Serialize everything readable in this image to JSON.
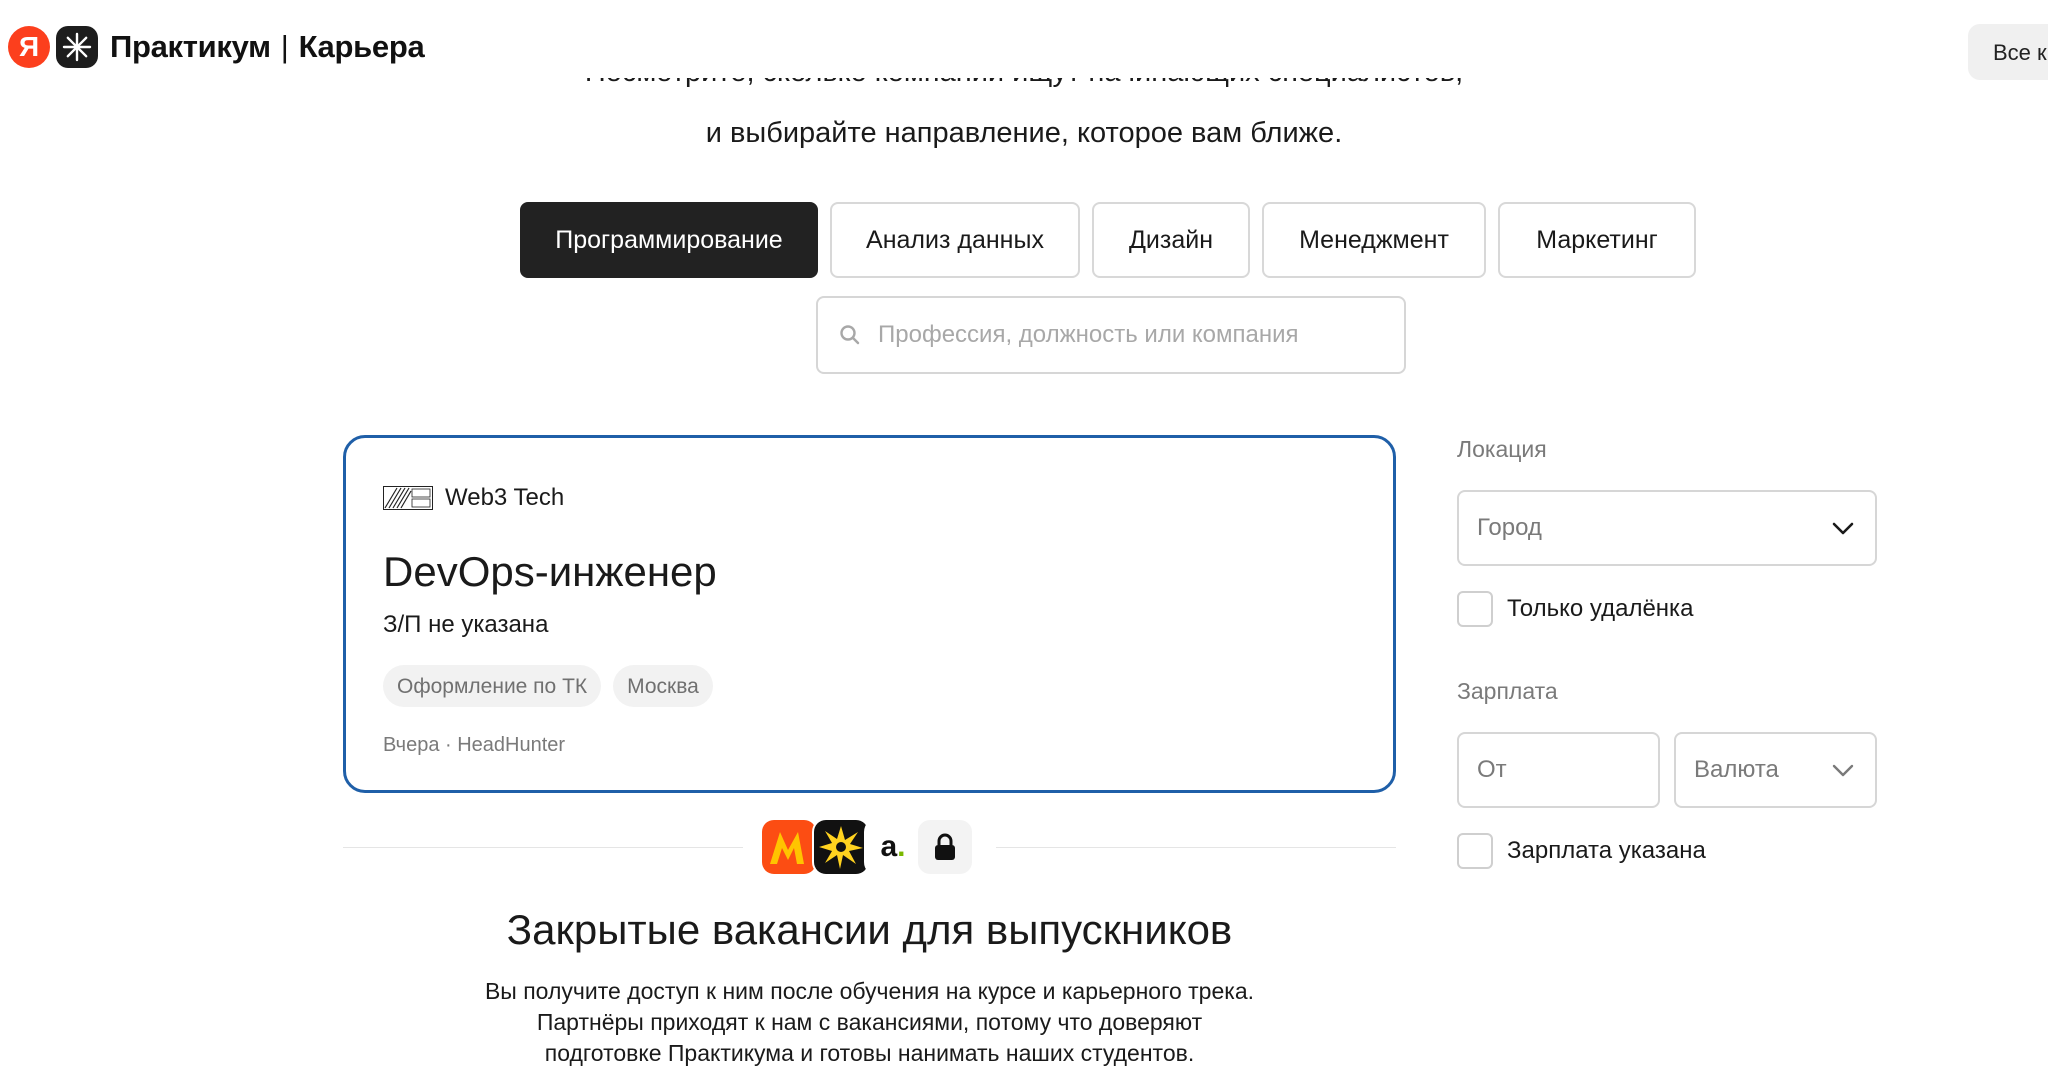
{
  "header": {
    "logo_letter": "Я",
    "brand": "Практикум",
    "separator": "|",
    "section": "Карьера",
    "all_button": "Все к"
  },
  "intro": {
    "line1_partial": "Посмотрите, сколько компаний ищут начинающих специалистов,",
    "line2": "и выбирайте направление, которое вам ближе."
  },
  "tabs": [
    {
      "label": "Программирование",
      "active": true
    },
    {
      "label": "Анализ данных",
      "active": false
    },
    {
      "label": "Дизайн",
      "active": false
    },
    {
      "label": "Менеджмент",
      "active": false
    },
    {
      "label": "Маркетинг",
      "active": false
    }
  ],
  "search": {
    "placeholder": "Профессия, должность или компания",
    "icon": "search-icon"
  },
  "vacancy": {
    "company": "Web3 Tech",
    "title": "DevOps-инженер",
    "salary": "З/П не указана",
    "tags": [
      "Оформление по ТК",
      "Москва"
    ],
    "meta": "Вчера · HeadHunter",
    "border_color": "#1f5fa8"
  },
  "partners": {
    "a_letter": "a",
    "a_dot": "."
  },
  "closed": {
    "title": "Закрытые вакансии для выпускников",
    "text": [
      "Вы получите доступ к ним после обучения на курсе и карьерного трека.",
      "Партнёры приходят к нам с вакансиями, потому что доверяют",
      "подготовке Практикума и готовы нанимать наших студентов."
    ]
  },
  "filters": {
    "location_label": "Локация",
    "city_placeholder": "Город",
    "remote_label": "Только удалёнка",
    "salary_label": "Зарплата",
    "from_placeholder": "От",
    "currency_placeholder": "Валюта",
    "salary_specified_label": "Зарплата указана"
  },
  "colors": {
    "active_tab": "#222222",
    "brand_red": "#fc3f1d",
    "card_border": "#1f5fa8"
  }
}
